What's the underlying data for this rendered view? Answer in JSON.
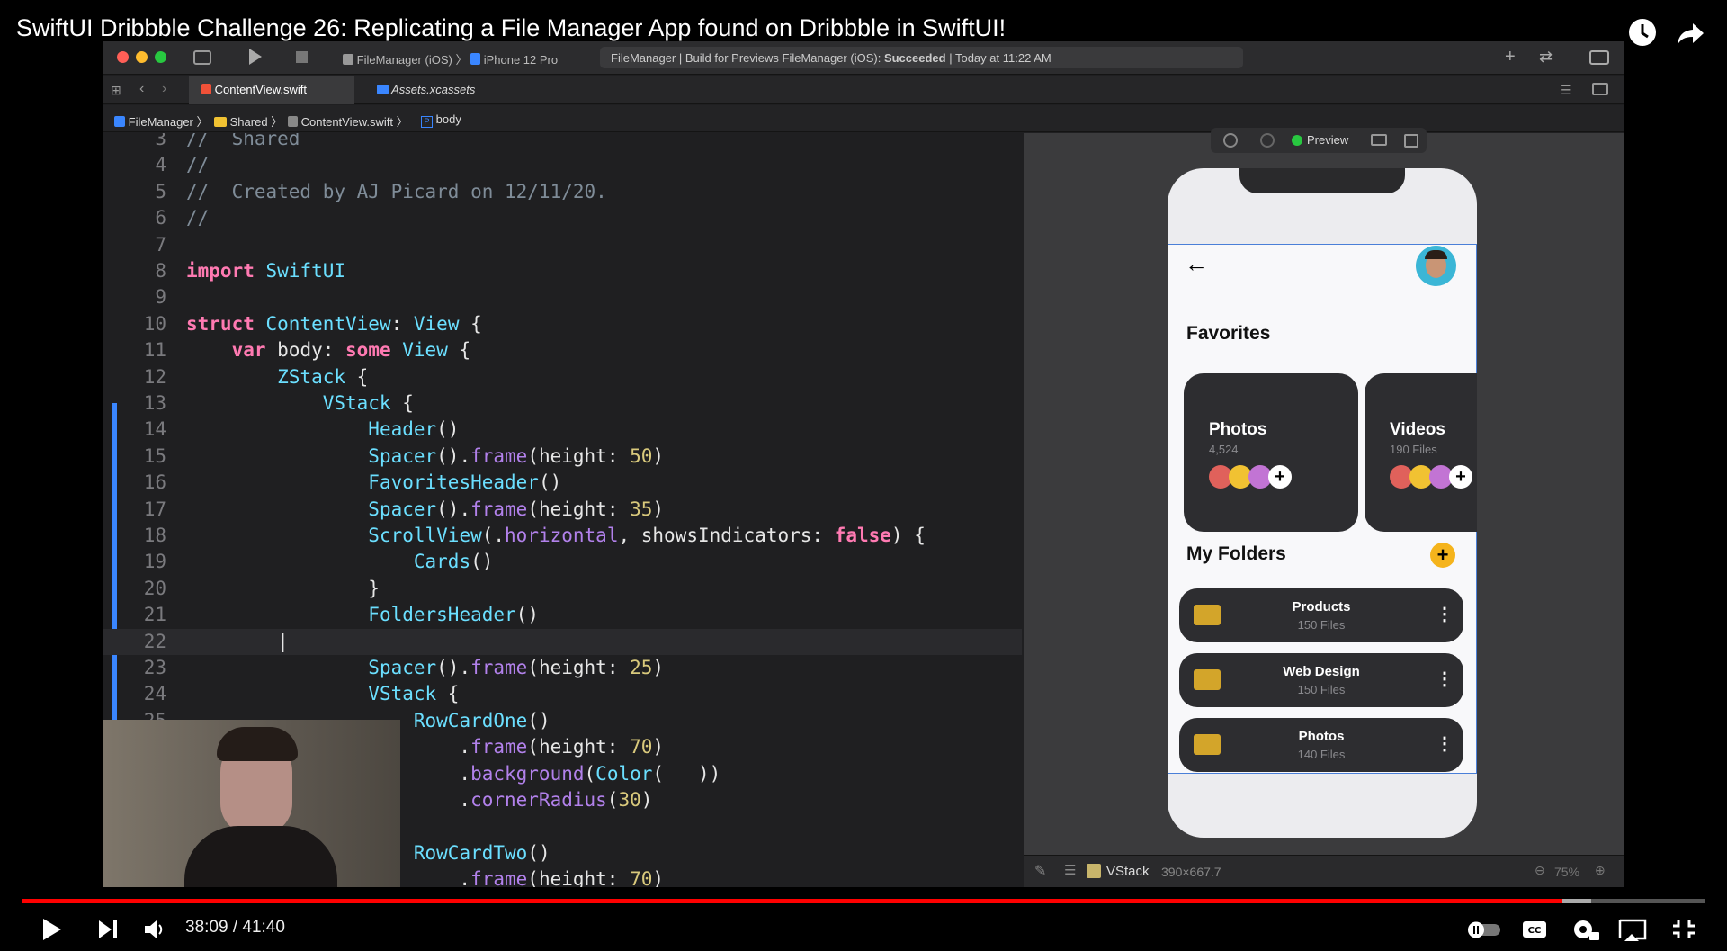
{
  "video": {
    "title": "SwiftUI Dribbble Challenge 26: Replicating a File Manager App found on Dribbble in SwiftUI!",
    "time_current": "38:09",
    "time_separator": " / ",
    "time_total": "41:40",
    "progress_fraction": 0.915
  },
  "xcode": {
    "scheme": "FileManager (iOS)",
    "device": "iPhone 12 Pro",
    "status_prefix": "FileManager | Build for Previews FileManager (iOS): ",
    "status_result": "Succeeded",
    "status_time": "| Today at 11:22 AM",
    "tabs": [
      "ContentView.swift",
      "Assets.xcassets"
    ],
    "breadcrumb": [
      "FileManager",
      "Shared",
      "ContentView.swift",
      "body"
    ],
    "canvas_selection": "VStack",
    "canvas_size": "390×667.7",
    "zoom": "75%",
    "preview_label": "Preview"
  },
  "code": {
    "lines": [
      {
        "n": "3",
        "t": "//  Shared"
      },
      {
        "n": "4",
        "t": "//"
      },
      {
        "n": "5",
        "t": "//  Created by AJ Picard on 12/11/20."
      },
      {
        "n": "6",
        "t": "//"
      },
      {
        "n": "7",
        "t": ""
      },
      {
        "n": "8",
        "t": "import SwiftUI"
      },
      {
        "n": "9",
        "t": ""
      },
      {
        "n": "10",
        "t": "struct ContentView: View {"
      },
      {
        "n": "11",
        "t": "    var body: some View {"
      },
      {
        "n": "12",
        "t": "        ZStack {"
      },
      {
        "n": "13",
        "t": "            VStack {"
      },
      {
        "n": "14",
        "t": "                Header()"
      },
      {
        "n": "15",
        "t": "                Spacer().frame(height: 50)"
      },
      {
        "n": "16",
        "t": "                FavoritesHeader()"
      },
      {
        "n": "17",
        "t": "                Spacer().frame(height: 35)"
      },
      {
        "n": "18",
        "t": "                ScrollView(.horizontal, showsIndicators: false) {"
      },
      {
        "n": "19",
        "t": "                    Cards()"
      },
      {
        "n": "20",
        "t": "                }"
      },
      {
        "n": "21",
        "t": "                FoldersHeader()"
      },
      {
        "n": "22",
        "t": "        |"
      },
      {
        "n": "23",
        "t": "                Spacer().frame(height: 25)"
      },
      {
        "n": "24",
        "t": "                VStack {"
      },
      {
        "n": "25",
        "t": "                    RowCardOne()"
      },
      {
        "n": "",
        "t": "                        .frame(height: 70)"
      },
      {
        "n": "",
        "t": "                        .background(Color(   ))"
      },
      {
        "n": "",
        "t": "                        .cornerRadius(30)"
      },
      {
        "n": "",
        "t": ""
      },
      {
        "n": "",
        "t": "                    RowCardTwo()"
      },
      {
        "n": "",
        "t": "                        .frame(height: 70)"
      }
    ]
  },
  "app": {
    "favorites_title": "Favorites",
    "cards": [
      {
        "title": "Photos",
        "subtitle": "4,524"
      },
      {
        "title": "Videos",
        "subtitle": "190 Files"
      }
    ],
    "folders_title": "My Folders",
    "folders": [
      {
        "title": "Products",
        "subtitle": "150 Files"
      },
      {
        "title": "Web Design",
        "subtitle": "150 Files"
      },
      {
        "title": "Photos",
        "subtitle": "140 Files"
      }
    ],
    "colors": {
      "accent": "#f5b41c",
      "card": "#2d2d30",
      "dot_red": "#e0615b",
      "dot_yellow": "#f1c232",
      "dot_purple": "#c274d4",
      "folder": "#f1c232"
    }
  }
}
